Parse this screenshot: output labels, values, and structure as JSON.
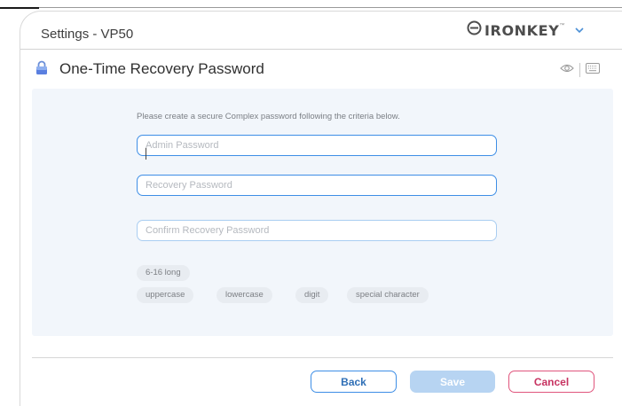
{
  "window": {
    "title": "Settings - VP50",
    "brand": {
      "name": "IRONKEY",
      "trademark": "™",
      "chevron_icon": "chevron-down-icon"
    }
  },
  "header": {
    "lock_icon": "lock-icon",
    "title": "One-Time Recovery Password",
    "icons": [
      "eye-icon",
      "keyboard-icon"
    ]
  },
  "form": {
    "instructions": "Please create a secure Complex password following the criteria below.",
    "admin_password": {
      "placeholder": "Admin Password",
      "value": ""
    },
    "recovery_password": {
      "placeholder": "Recovery Password",
      "value": ""
    },
    "confirm_password": {
      "placeholder": "Confirm Recovery Password",
      "value": ""
    },
    "criteria": [
      "6-16 long",
      "uppercase",
      "lowercase",
      "digit",
      "special character"
    ]
  },
  "footer": {
    "back_label": "Back",
    "save_label": "Save",
    "cancel_label": "Cancel"
  },
  "colors": {
    "accent": "#3e8ee6",
    "cancel": "#e0557d",
    "panel": "#f2f6fb"
  }
}
